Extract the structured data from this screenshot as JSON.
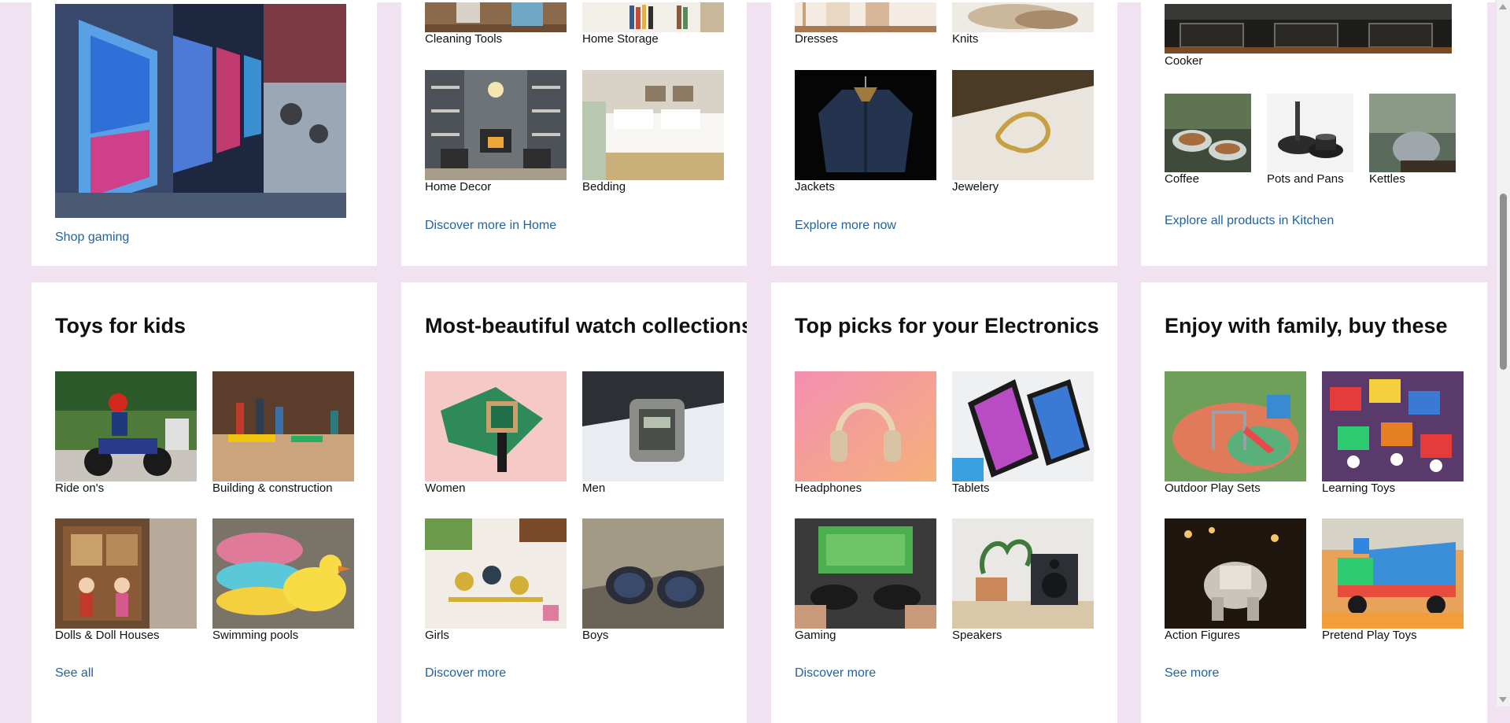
{
  "cards_top": [
    {
      "link": "Shop gaming"
    },
    {
      "tiles": [
        {
          "label": "Cleaning Tools"
        },
        {
          "label": "Home Storage"
        },
        {
          "label": "Home Decor"
        },
        {
          "label": "Bedding"
        }
      ],
      "link": "Discover more in Home"
    },
    {
      "tiles": [
        {
          "label": "Dresses"
        },
        {
          "label": "Knits"
        },
        {
          "label": "Jackets"
        },
        {
          "label": "Jewelery"
        }
      ],
      "link": "Explore more now"
    },
    {
      "tiles": [
        {
          "label": "Cooker"
        },
        {
          "label": "Coffee"
        },
        {
          "label": "Pots and Pans"
        },
        {
          "label": "Kettles"
        }
      ],
      "link": "Explore all products in Kitchen"
    }
  ],
  "cards_bottom": [
    {
      "title": "Toys for kids",
      "tiles": [
        {
          "label": "Ride on's"
        },
        {
          "label": "Building & construction"
        },
        {
          "label": "Dolls & Doll Houses"
        },
        {
          "label": "Swimming pools"
        }
      ],
      "link": "See all"
    },
    {
      "title": "Most-beautiful watch collections",
      "tiles": [
        {
          "label": "Women"
        },
        {
          "label": "Men"
        },
        {
          "label": "Girls"
        },
        {
          "label": "Boys"
        }
      ],
      "link": "Discover more"
    },
    {
      "title": "Top picks for your Electronics",
      "tiles": [
        {
          "label": "Headphones"
        },
        {
          "label": "Tablets"
        },
        {
          "label": "Gaming"
        },
        {
          "label": "Speakers"
        }
      ],
      "link": "Discover more"
    },
    {
      "title": "Enjoy with family, buy these",
      "tiles": [
        {
          "label": "Outdoor Play Sets"
        },
        {
          "label": "Learning Toys"
        },
        {
          "label": "Action Figures"
        },
        {
          "label": "Pretend Play Toys"
        }
      ],
      "link": "See more"
    }
  ],
  "colors": {
    "page_background": "#f1e2f1",
    "card_background": "#ffffff",
    "link": "#2162a1",
    "text": "#0f1111"
  }
}
